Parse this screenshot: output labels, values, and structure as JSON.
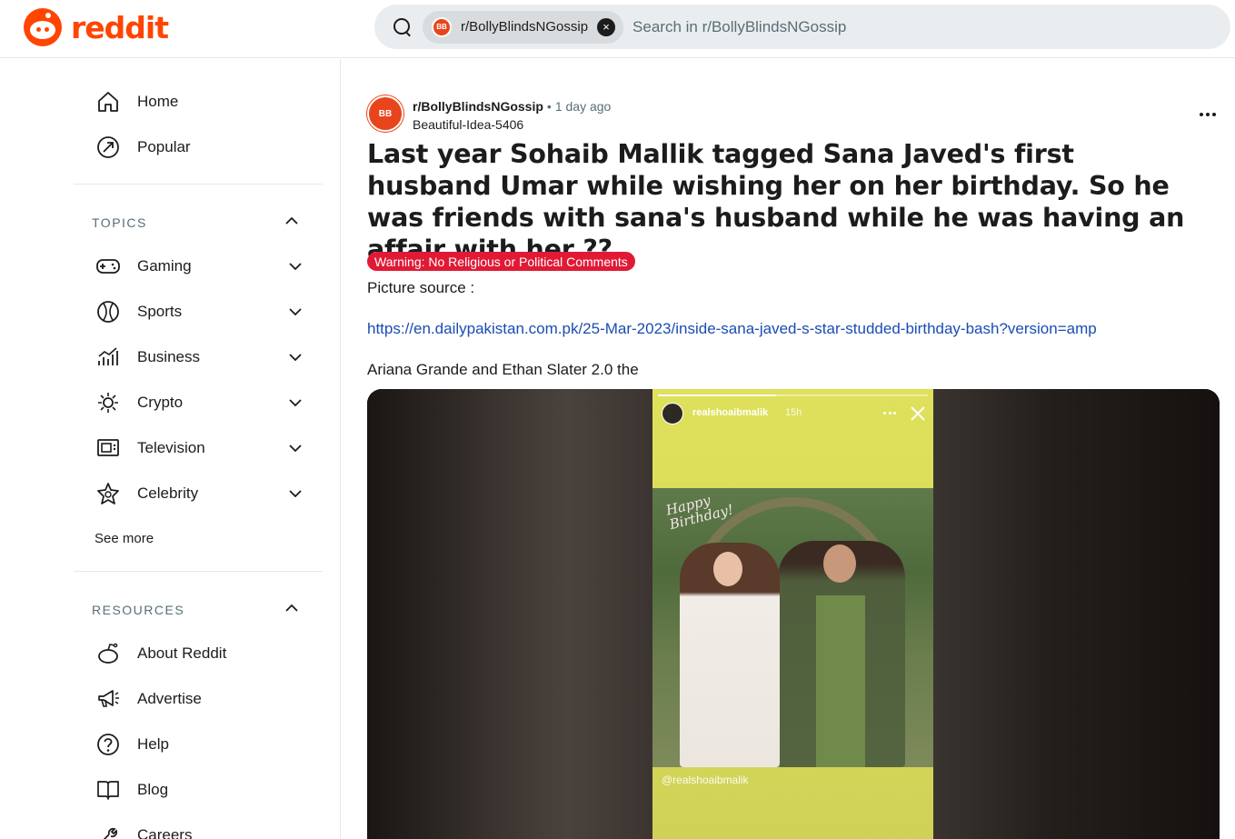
{
  "header": {
    "logo_text": "reddit",
    "search_chip_label": "r/BollyBlindsNGossip",
    "search_placeholder": "Search in r/BollyBlindsNGossip"
  },
  "sidebar": {
    "nav": [
      {
        "label": "Home",
        "icon": "home-icon"
      },
      {
        "label": "Popular",
        "icon": "popular-icon"
      }
    ],
    "topics_title": "TOPICS",
    "topics": [
      {
        "label": "Gaming",
        "icon": "gamepad-icon"
      },
      {
        "label": "Sports",
        "icon": "ball-icon"
      },
      {
        "label": "Business",
        "icon": "chart-icon"
      },
      {
        "label": "Crypto",
        "icon": "crypto-icon"
      },
      {
        "label": "Television",
        "icon": "tv-icon"
      },
      {
        "label": "Celebrity",
        "icon": "star-icon"
      }
    ],
    "see_more": "See more",
    "resources_title": "RESOURCES",
    "resources": [
      {
        "label": "About Reddit",
        "icon": "reddit-icon"
      },
      {
        "label": "Advertise",
        "icon": "megaphone-icon"
      },
      {
        "label": "Help",
        "icon": "help-icon"
      },
      {
        "label": "Blog",
        "icon": "book-icon"
      },
      {
        "label": "Careers",
        "icon": "careers-icon"
      }
    ]
  },
  "post": {
    "subreddit": "r/BollyBlindsNGossip",
    "separator": "•",
    "time": "1 day ago",
    "author": "Beautiful-Idea-5406",
    "title": "Last year Sohaib Mallik tagged Sana Javed's first husband Umar while wishing her on her birthday. So he was friends with sana's husband while he was having an affair with her ??",
    "flair": "Warning: No Religious or Political Comments",
    "flair_color": "#e01a35",
    "body_line1": "Picture source :",
    "body_link": "https://en.dailypakistan.com.pk/25-Mar-2023/inside-sana-javed-s-star-studded-birthday-bash?version=amp",
    "body_line2": "Ariana Grande and Ethan Slater 2.0 the"
  },
  "story": {
    "username": "realshoaibmalik",
    "time": "15h",
    "greeting_line1": "Happy",
    "greeting_line2": "Birthday!",
    "handle": "@realshoaibmalik"
  }
}
